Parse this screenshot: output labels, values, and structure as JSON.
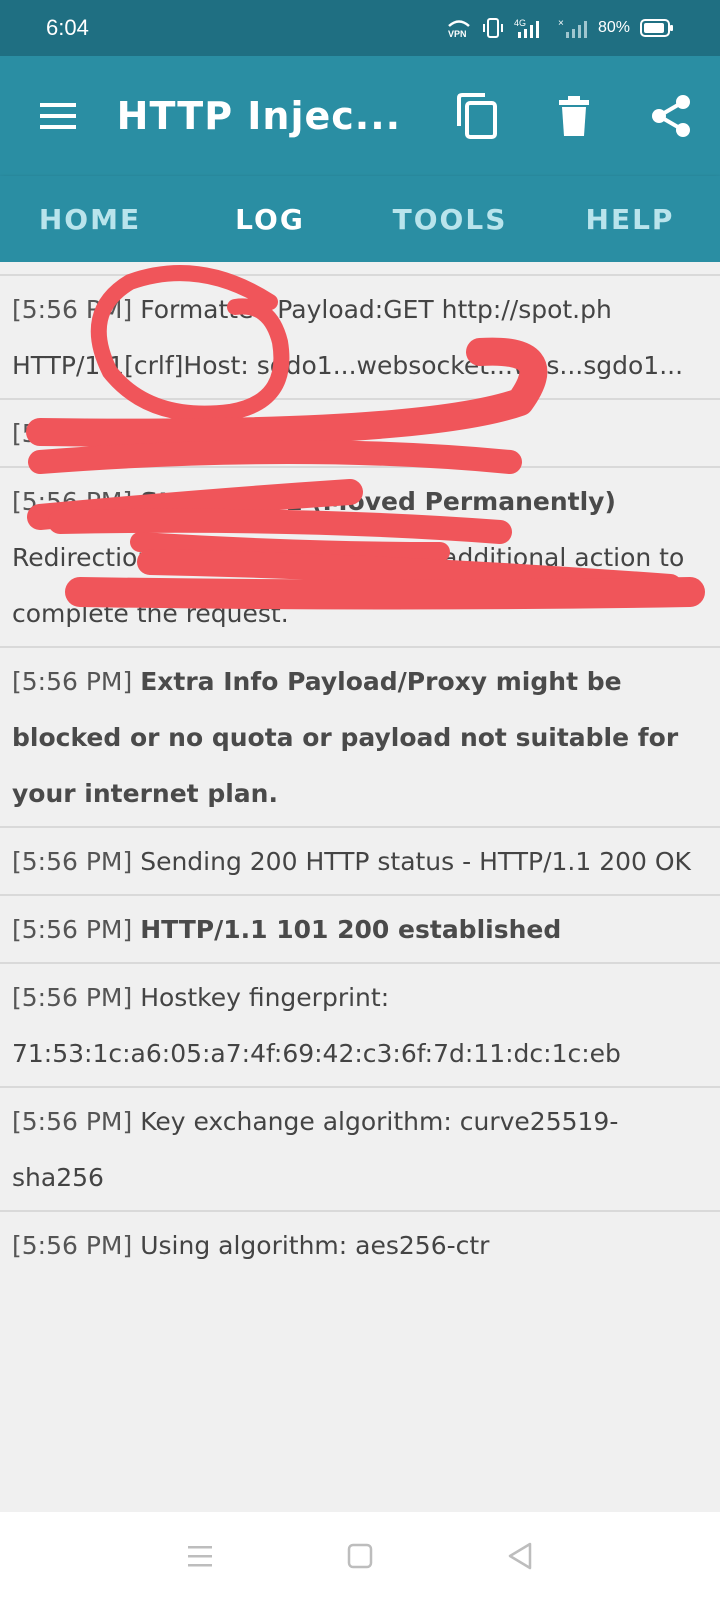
{
  "status_bar": {
    "time": "6:04",
    "network": "4G",
    "vpn": "VPN",
    "battery": "80%"
  },
  "app_bar": {
    "title": "HTTP Injec...",
    "icons": [
      "menu-icon",
      "copy-icon",
      "trash-icon",
      "share-icon"
    ]
  },
  "tabs": [
    {
      "label": "HOME",
      "active": false
    },
    {
      "label": "LOG",
      "active": true
    },
    {
      "label": "TOOLS",
      "active": false
    },
    {
      "label": "HELP",
      "active": false
    }
  ],
  "log": {
    "entries": [
      {
        "time": "[5:56 PM]",
        "text": "Formatted Payload:GET http://spot.ph HTTP/1.1[crlf]Host: sgdo1...websocket...wss...sgdo1..."
      },
      {
        "time": "[5:56 PM]",
        "text": "Injecting"
      },
      {
        "time": "[5:56 PM]",
        "text": "Status: 301 (Moved Permanently)",
        "text2": "Redirection - The client must take additional action to complete the request."
      },
      {
        "time": "[5:56 PM]",
        "text": "Extra Info Payload/Proxy might be blocked or no quota or payload not suitable for your internet plan."
      },
      {
        "time": "[5:56 PM]",
        "text": "Sending 200 HTTP status - HTTP/1.1 200 OK"
      },
      {
        "time": "[5:56 PM]",
        "text": "HTTP/1.1 101 200 established"
      },
      {
        "time": "[5:56 PM]",
        "text": "Hostkey fingerprint: 71:53:1c:a6:05:a7:4f:69:42:c3:6f:7d:11:dc:1c:eb"
      },
      {
        "time": "[5:56 PM]",
        "text": "Key exchange algorithm: curve25519-sha256"
      },
      {
        "time": "[5:56 PM]",
        "text": "Using algorithm: aes256-ctr"
      }
    ]
  },
  "colors": {
    "status_bar": "#1f6f82",
    "app_bar": "#2a8ea3",
    "scribble": "#f0555a"
  }
}
